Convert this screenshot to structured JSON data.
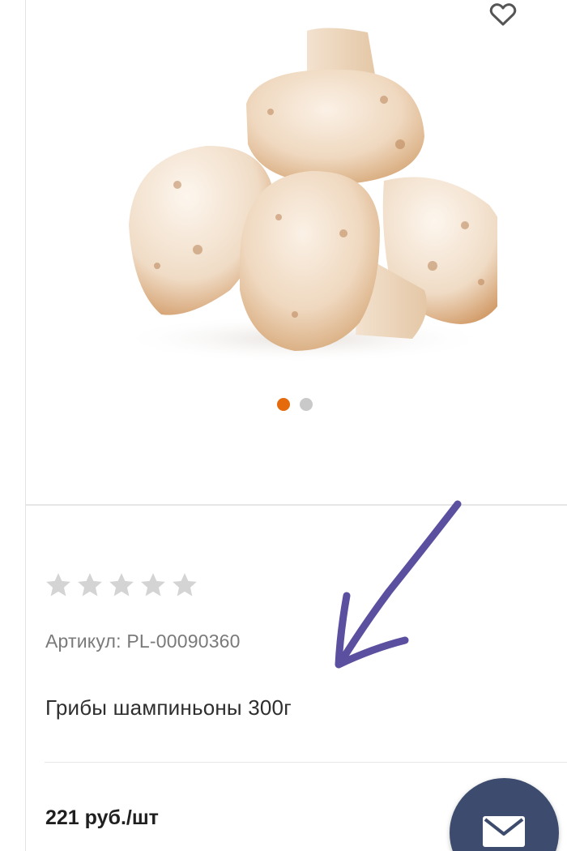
{
  "product": {
    "sku_label": "Артикул:",
    "sku_value": "PL-00090360",
    "title": "Грибы шампиньоны 300г",
    "price": "221 руб./шт",
    "rating_stars": 5,
    "rating_value": 0
  },
  "gallery": {
    "slide_count": 2,
    "active_slide": 1
  },
  "icons": {
    "favorite": "heart-outline-icon",
    "contact": "mail-icon",
    "rating": "star-icon"
  },
  "colors": {
    "accent_dot": "#e46a0c",
    "inactive_dot": "#c9c9c9",
    "star": "#d4d4d4",
    "fab": "#3d4c6e",
    "annotation_arrow": "#5b4fa0"
  }
}
